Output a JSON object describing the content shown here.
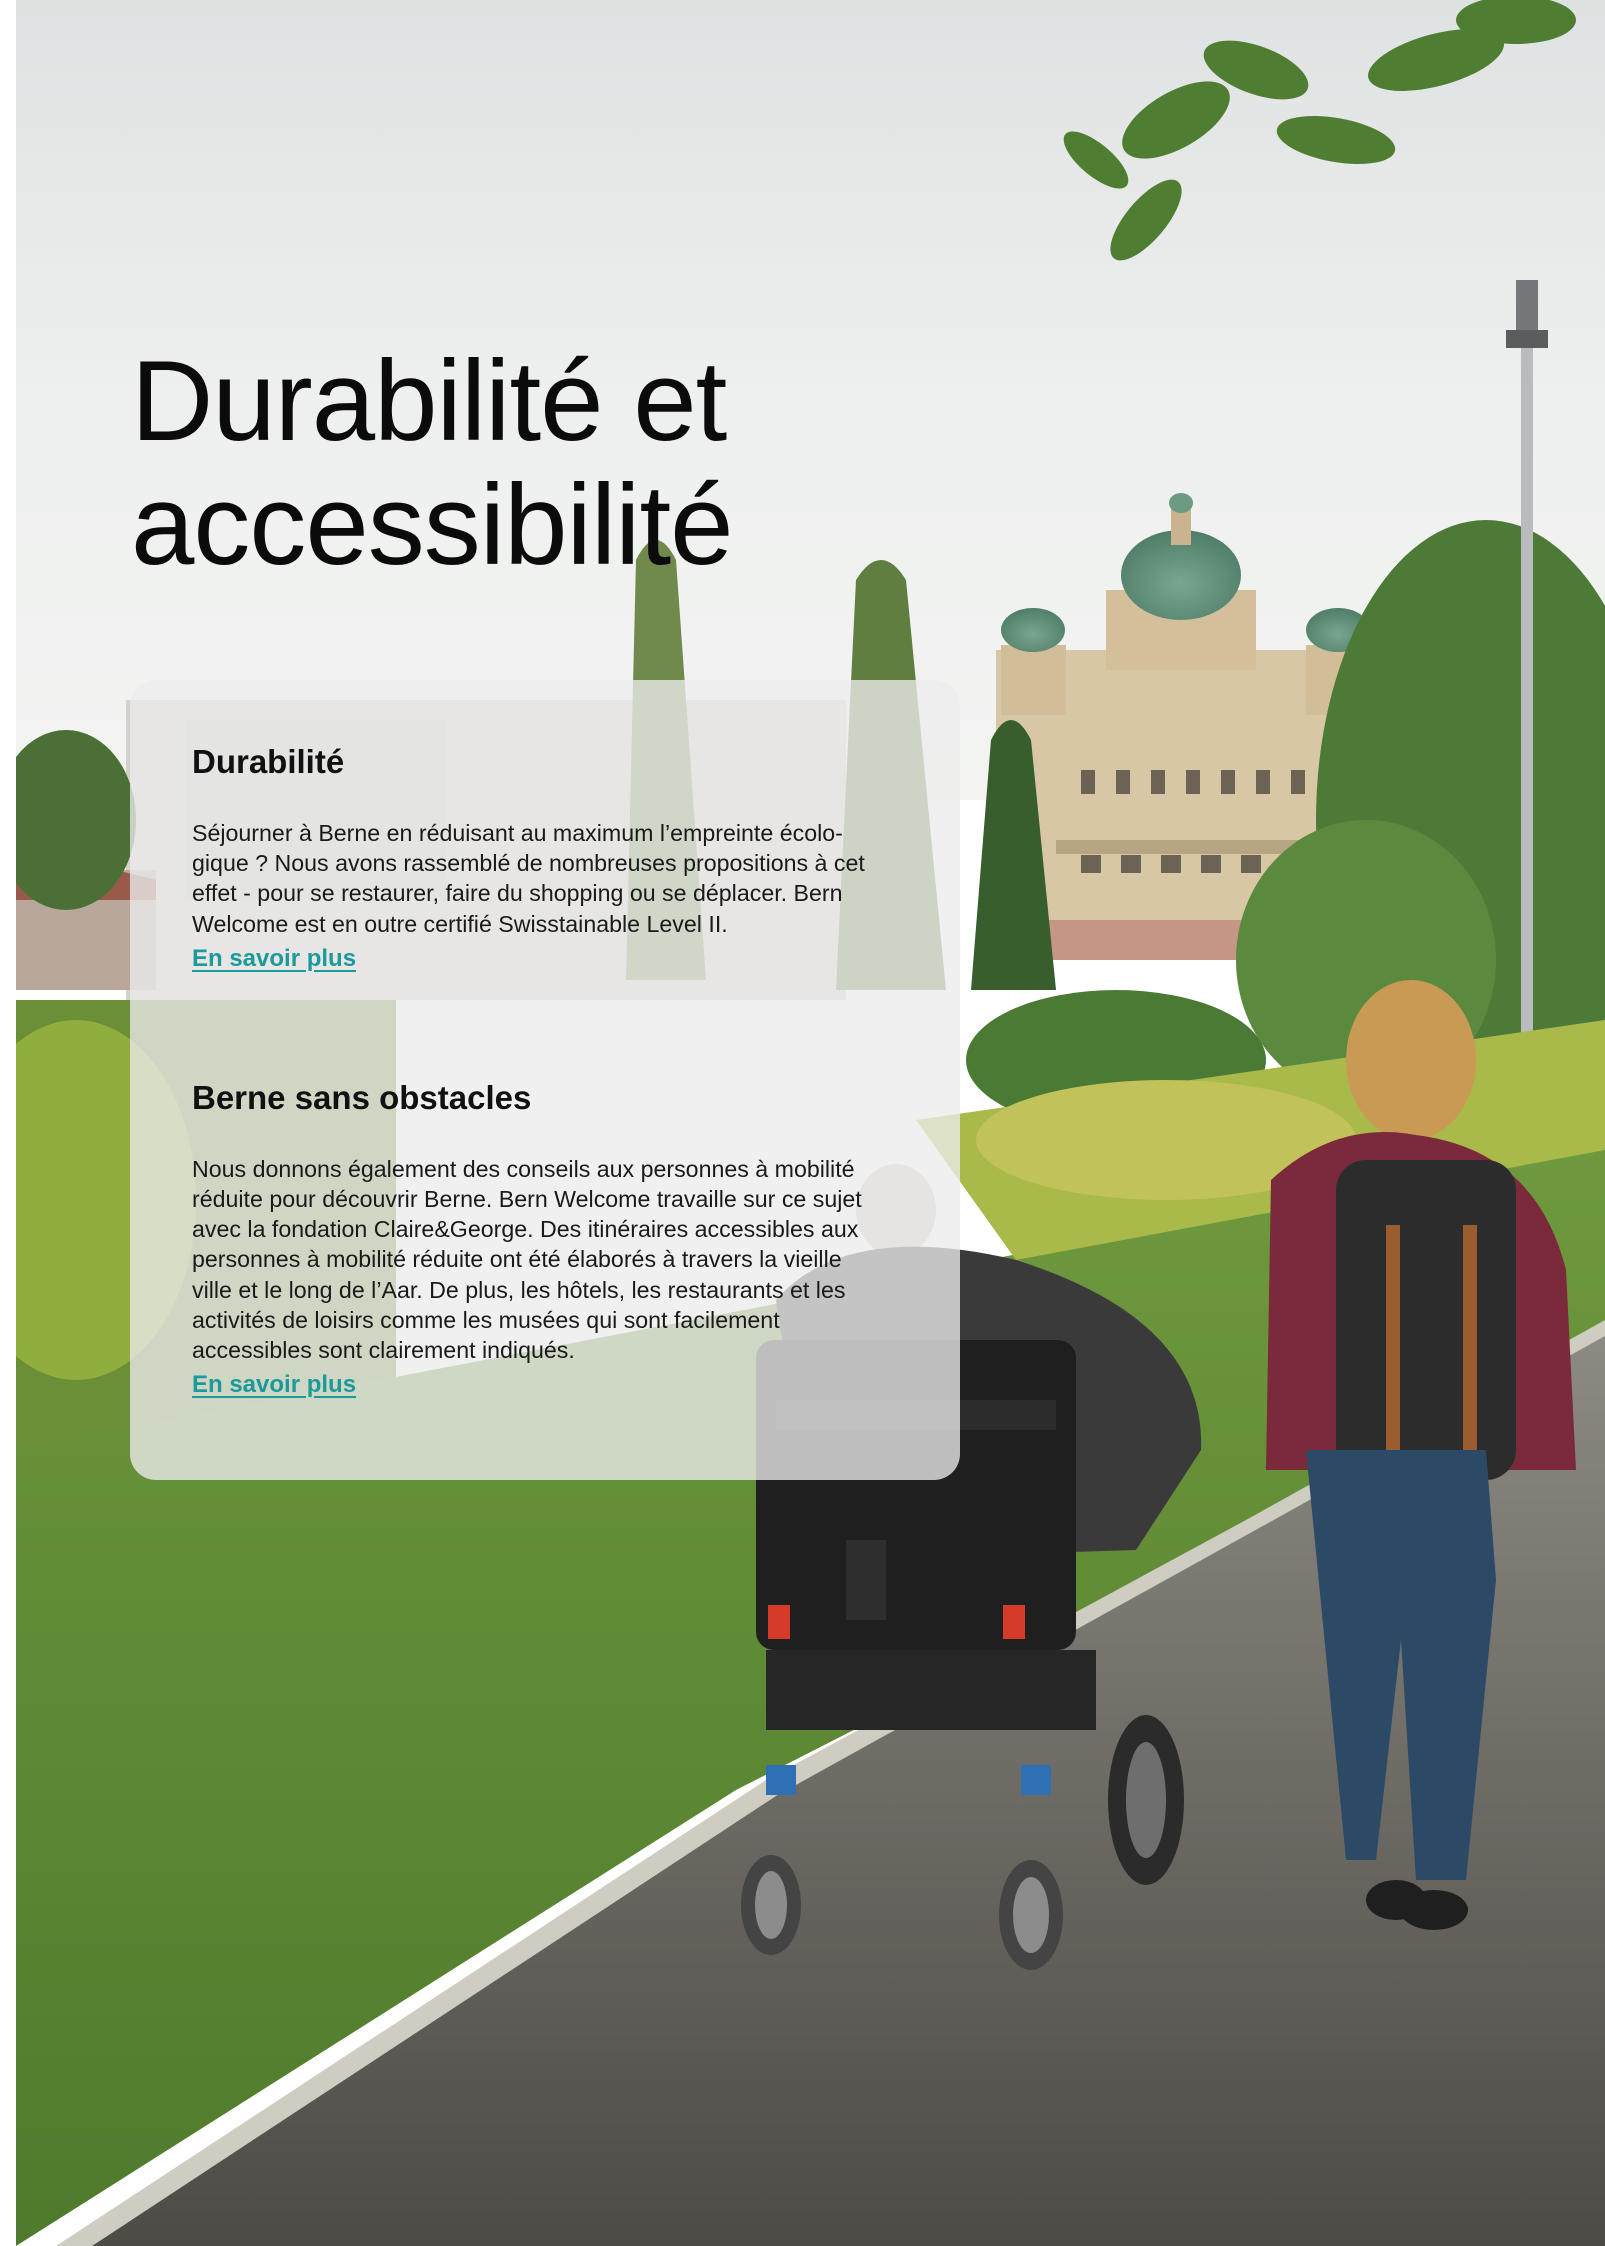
{
  "page": {
    "title_lines": [
      "Durabilité et",
      "accessibilité"
    ],
    "accent_color": "#1a9a9a"
  },
  "photo": {
    "description_hidden": "",
    "alt": ""
  },
  "sections": [
    {
      "heading": "Durabilité",
      "body_lines": [
        "Séjourner à Berne en réduisant au maximum l’empreinte écolo-",
        "gique ? Nous avons rassemblé de nombreuses propositions à cet",
        "effet - pour se restaurer, faire du shopping ou se déplacer. Bern",
        "Welcome est en outre certifié Swisstainable Level II."
      ],
      "link": "En savoir plus"
    },
    {
      "heading": "Berne sans obstacles",
      "body_lines": [
        "Nous donnons également des conseils aux personnes à mobilité",
        "réduite pour découvrir Berne. Bern Welcome travaille sur ce sujet",
        "avec la fondation Claire&George. Des itinéraires accessibles aux",
        "personnes à mobilité réduite ont été élaborés à travers la vieille",
        "ville et le long de l’Aar. De plus, les hôtels, les restaurants et les",
        "activités de loisirs comme les musées qui sont facilement",
        "accessibles sont clairement indiqués."
      ],
      "link": "En savoir plus"
    }
  ]
}
